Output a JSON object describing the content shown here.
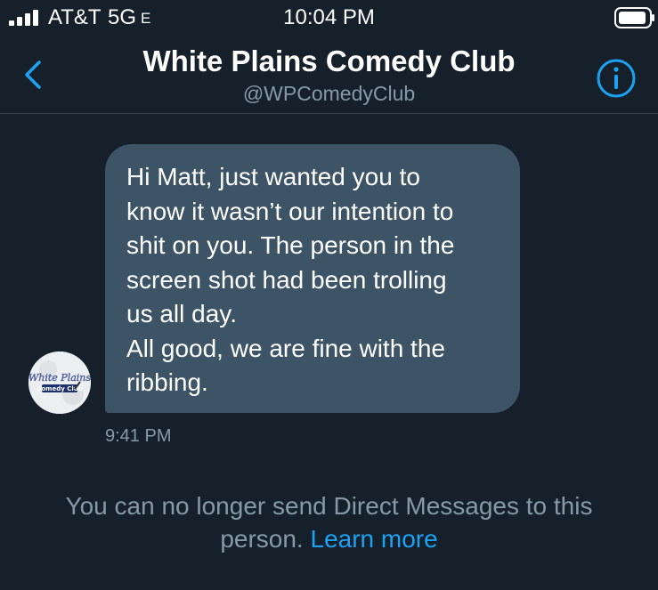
{
  "status_bar": {
    "carrier": "AT&T",
    "network": "5G",
    "network_suffix": "E",
    "time": "10:04 PM"
  },
  "header": {
    "title": "White Plains Comedy Club",
    "handle": "@WPComedyClub"
  },
  "conversation": {
    "avatar_text": [
      "White Plains",
      "Comedy Club"
    ],
    "message_lines": [
      "Hi Matt, just wanted you to",
      "know it wasn’t our intention to",
      "shit on you. The person in the",
      "screen shot had been trolling",
      "us all day.",
      "All good, we are fine with the",
      "ribbing."
    ],
    "timestamp": "9:41 PM"
  },
  "footer": {
    "notice_line1": "You can no longer send Direct Messages to this",
    "notice_line2": "person.",
    "learn_more": "Learn more"
  },
  "colors": {
    "background": "#15202b",
    "bubble": "#3d5466",
    "accent": "#1da1f2",
    "secondary_text": "#8899a6"
  },
  "icons": {
    "back": "chevron-left-icon",
    "info": "info-circle-icon",
    "signal": "cellular-signal-icon",
    "battery": "battery-icon"
  }
}
